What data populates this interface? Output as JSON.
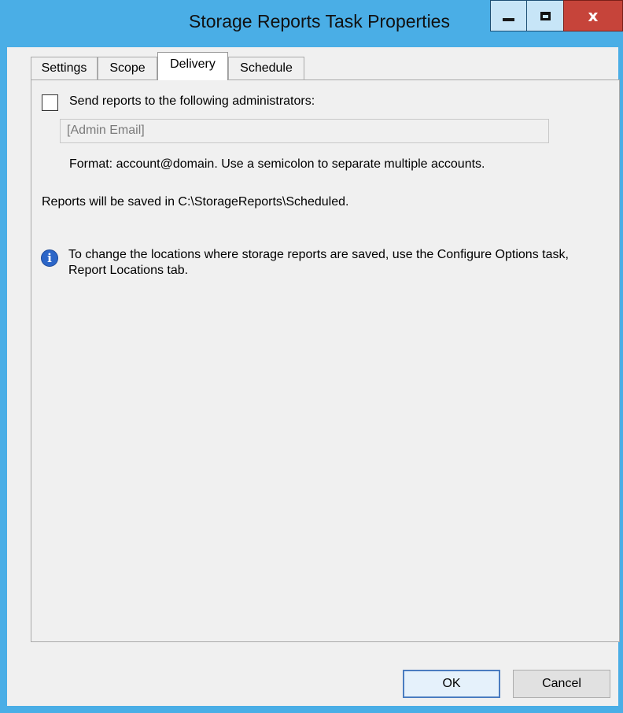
{
  "window": {
    "title": "Storage Reports Task Properties",
    "close_glyph": "x"
  },
  "tabs": [
    {
      "label": "Settings",
      "active": false
    },
    {
      "label": "Scope",
      "active": false
    },
    {
      "label": "Delivery",
      "active": true
    },
    {
      "label": "Schedule",
      "active": false
    }
  ],
  "delivery": {
    "send_checkbox_label": "Send reports to the following administrators:",
    "send_checked": false,
    "email_field_value": "[Admin Email]",
    "format_hint": "Format: account@domain. Use a semicolon to separate multiple accounts.",
    "save_location_text": "Reports will be saved in C:\\StorageReports\\Scheduled.",
    "info_text": "To change the locations where storage reports are saved, use the Configure Options task, Report Locations tab.",
    "info_icon_glyph": "i"
  },
  "buttons": {
    "ok_label": "OK",
    "cancel_label": "Cancel"
  },
  "colors": {
    "titlebar": "#4aaee6",
    "close_button": "#c6443a",
    "dialog_background": "#f0f0f0",
    "default_button_border": "#4a7cc0"
  },
  "icons": {
    "minimize": "minimize-icon",
    "maximize": "maximize-icon",
    "close": "close-icon",
    "info": "info-icon"
  }
}
